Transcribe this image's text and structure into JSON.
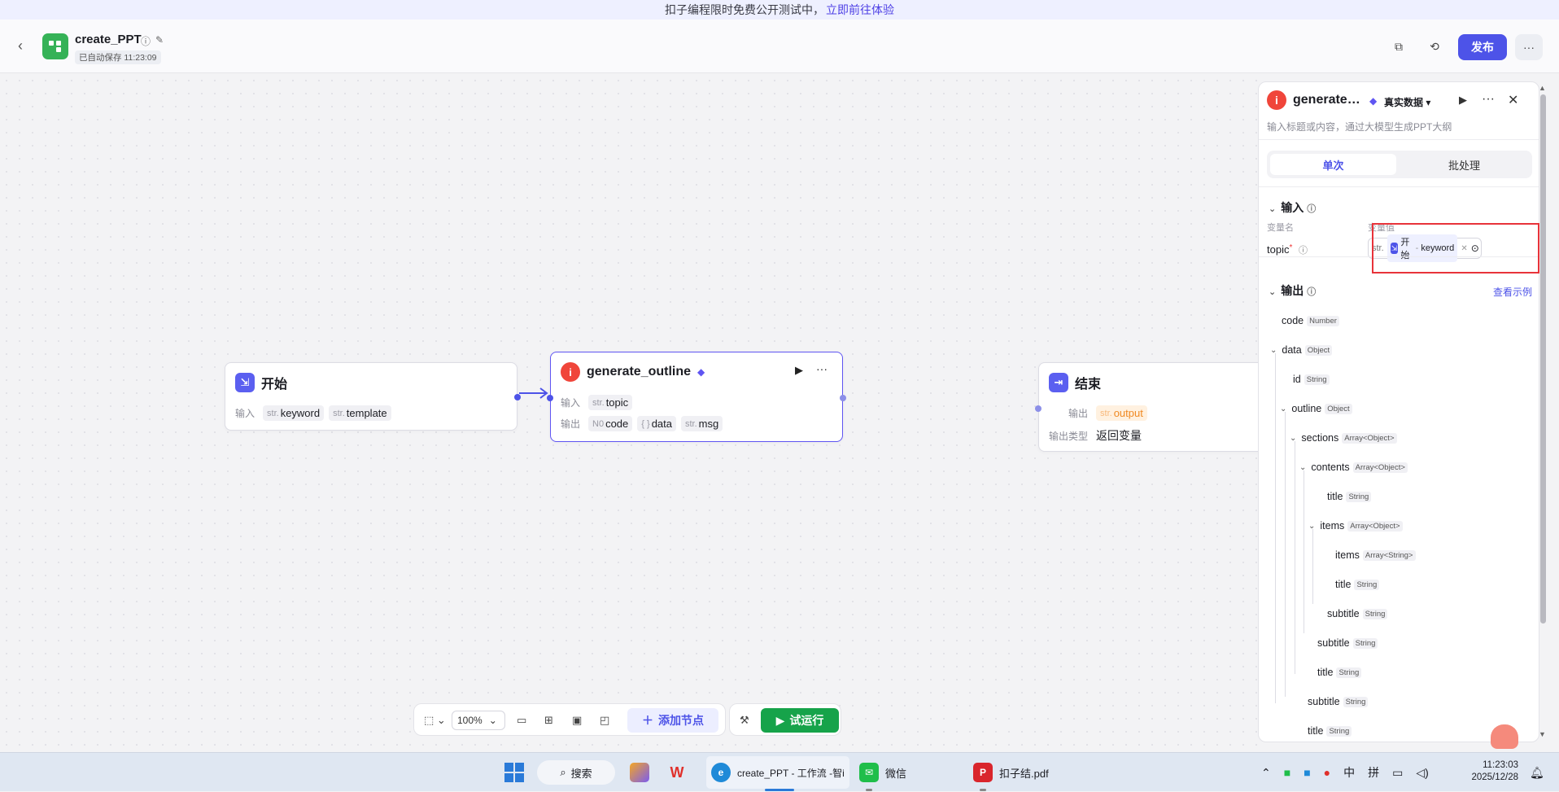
{
  "banner": {
    "text": "扣子编程限时免费公开测试中，",
    "link": "立即前往体验"
  },
  "header": {
    "title": "create_PPT",
    "autosave": "已自动保存 11:23:09",
    "publish": "发布"
  },
  "nodes": {
    "start": {
      "title": "开始",
      "input_label": "输入",
      "inputs": [
        {
          "type": "str.",
          "name": "keyword"
        },
        {
          "type": "str.",
          "name": "template"
        }
      ]
    },
    "generate": {
      "title": "generate_outline",
      "input_label": "输入",
      "output_label": "输出",
      "inputs": [
        {
          "type": "str.",
          "name": "topic"
        }
      ],
      "outputs": [
        {
          "type": "N0",
          "name": "code"
        },
        {
          "type": "{ }",
          "name": "data"
        },
        {
          "type": "str.",
          "name": "msg"
        }
      ]
    },
    "end": {
      "title": "结束",
      "output_label": "输出",
      "output": {
        "type": "str.",
        "name": "output"
      },
      "output_type_label": "输出类型",
      "output_type": "返回变量"
    }
  },
  "panel": {
    "title": "generate_outline",
    "mode": "真实数据",
    "desc": "输入标题或内容，通过大模型生成PPT大纲",
    "tabs": [
      "单次",
      "批处理"
    ],
    "input_section": "输入",
    "col_name": "变量名",
    "col_value": "变量值",
    "topic": "topic",
    "topic_type": "str.",
    "ref_source": "开始",
    "ref_sep": "-",
    "ref_var": "keyword",
    "output_section": "输出",
    "see_example": "查看示例",
    "tree": [
      {
        "name": "code",
        "type": "Number"
      },
      {
        "name": "data",
        "type": "Object"
      },
      {
        "name": "id",
        "type": "String"
      },
      {
        "name": "outline",
        "type": "Object"
      },
      {
        "name": "sections",
        "type": "Array<Object>"
      },
      {
        "name": "contents",
        "type": "Array<Object>"
      },
      {
        "name": "title",
        "type": "String"
      },
      {
        "name": "items",
        "type": "Array<Object>"
      },
      {
        "name": "items",
        "type": "Array<String>"
      },
      {
        "name": "title",
        "type": "String"
      },
      {
        "name": "subtitle",
        "type": "String"
      },
      {
        "name": "subtitle",
        "type": "String"
      },
      {
        "name": "title",
        "type": "String"
      },
      {
        "name": "subtitle",
        "type": "String"
      },
      {
        "name": "title",
        "type": "String"
      }
    ]
  },
  "toolbar": {
    "zoom": "100%",
    "add_node": "添加节点",
    "trial_run": "试运行"
  },
  "taskbar": {
    "search": "搜索",
    "edge_title": "create_PPT - 工作流 -智i",
    "wechat": "微信",
    "pdf": "扣子结.pdf",
    "ime1": "中",
    "ime2": "拼",
    "time": "11:23:03",
    "date": "2025/12/28"
  },
  "colors": {
    "accent": "#4d53e8",
    "green": "#16a34a",
    "highlight": "#e8333a"
  }
}
